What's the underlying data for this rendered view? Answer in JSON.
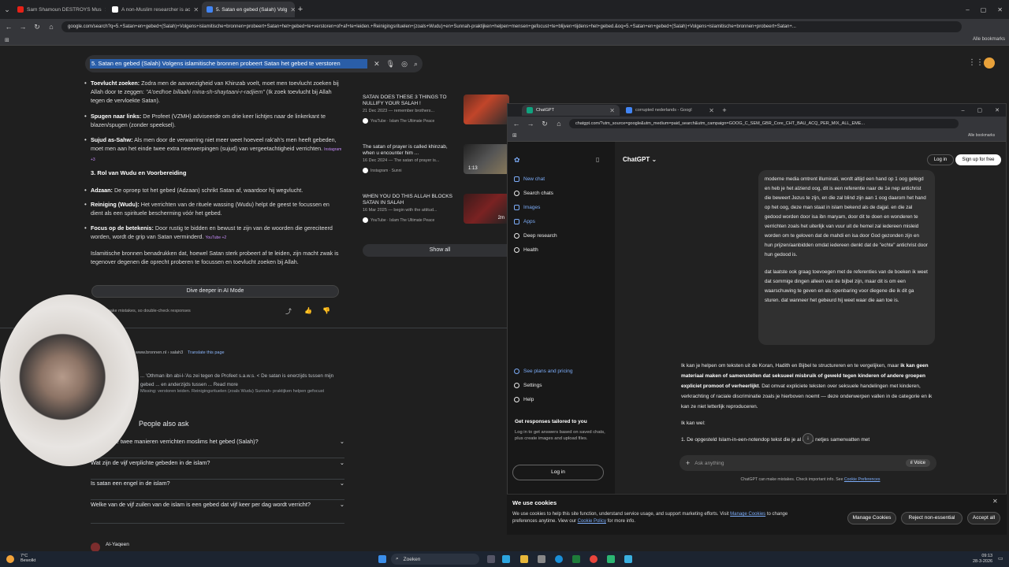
{
  "browser": {
    "tabs": [
      {
        "label": "Sam Shamoun DESTROYS Mus",
        "fav": "#e62117"
      },
      {
        "label": "A non-Muslim researcher is ac",
        "fav": "#ffffff"
      },
      {
        "label": "5. Satan en gebed (Salah) Volg",
        "fav": "#4285f4",
        "active": true
      }
    ],
    "url": "google.com/search?q=5.+Satan+en+gebed+(Salah)+Volgens+islamitische+bronnen+probeert+Satan+het+gebed+te+verstoren+of+af+te+leiden.+Reinigingsrituelen+(zoals+Wudu)+en+Sunnah-praktijken+helpen+mensen+gefocust+te+blijven+tijdens+het+gebed.&oq=5.+Satan+en+gebed+(Salah)+Volgens+islamitische+bronnen+probeert+Satan+...",
    "all_bookmarks": "Alle bookmarks"
  },
  "google": {
    "query": "5. Satan en gebed (Salah) Volgens islamitische bronnen probeert Satan het gebed te verstoren",
    "bullets": [
      {
        "bold": "Toevlucht zoeken:",
        "text": " Zodra men de aanwezigheid van Khinzab voelt, moet men toevlucht zoeken bij Allah door te zeggen: ",
        "italic": "\"A'oedhoe billaahi mina-sh-shaytaani-r-radjiem\"",
        "tail": " (Ik zoek toevlucht bij Allah tegen de vervloekte Satan)."
      },
      {
        "bold": "Spugen naar links:",
        "text": " De Profeet (VZMH) adviseerde om drie keer lichtjes naar de linkerkant te blazen/spugen (zonder speeksel)."
      },
      {
        "bold": "Sujud as-Sahw:",
        "text": " Als men door de verwarring niet meer weet hoeveel rak'ah's men heeft gebeden, moet men aan het einde twee extra neerwerpingen (sujud) van vergeetachtigheid verrichten. ",
        "src": "Instagram +3"
      }
    ],
    "heading3": "3. Rol van Wudu en Voorbereiding",
    "bullets2": [
      {
        "bold": "Adzaan:",
        "text": " De oproep tot het gebed (Adzaan) schrikt Satan af, waardoor hij wegvlucht."
      },
      {
        "bold": "Reiniging (Wudu):",
        "text": " Het verrichten van de rituele wassing (Wudu) helpt de geest te focussen en dient als een spirituele bescherming vóór het gebed."
      },
      {
        "bold": "Focus op de betekenis:",
        "text": " Door rustig te bidden en bewust te zijn van de woorden die gereciteerd worden, wordt de grip van Satan verminderd. ",
        "src": "YouTube +2"
      }
    ],
    "summary": "Islamitische bronnen benadrukken dat, hoewel Satan sterk probeert af te leiden, zijn macht zwak is tegenover degenen die oprecht proberen te focussen en toevlucht zoeken bij Allah.",
    "dive_deeper": "Dive deeper in AI Mode",
    "ai_disclaimer": "AI can make mistakes, so double-check responses",
    "result_site": "islamoonline",
    "result_url": "www.bronnen.nl › salah3",
    "translate": "Translate this page",
    "result_snippet": "... 'Othman ibn abi-l-'As zei tegen de Profeet s.a.w.s. < De satan is enerzijds tussen mijn gebed ... en anderzijds tussen ... Read more",
    "result_snippet2": "Missing: verstoren leiden. Reinigingsrituelen (zoals Wudu) Sunnah- praktijken helpen gefocust",
    "paa_title": "People also ask",
    "paa": [
      "Wat zijn de twee manieren verrichten moslims het gebed (Salah)?",
      "Wat zijn de vijf verplichte gebeden in de islam?",
      "Is satan een engel in de islam?",
      "Welke van de vijf zuilen van de islam is een gebed dat vijf keer per dag wordt verricht?"
    ],
    "last_result": "Al-Yaqeen",
    "videos": [
      {
        "title": "SATAN DOES THESE 3 THINGS TO NULLIFY YOUR SALAH !",
        "sub": "21 Dec 2023 — remember brothers...",
        "channel": "YouTube · Islam The Ultimate Peace",
        "dur": ""
      },
      {
        "title": "The satan of prayer is called khinzab, when u encounter him ...",
        "sub": "16 Dec 2024 — The satan of prayer is...",
        "channel": "Instagram · Sunni",
        "dur": "1:13"
      },
      {
        "title": "WHEN YOU DO THIS ALLAH BLOCKS SATAN IN SALAH",
        "sub": "16 Mar 2025 — begin with the attitud...",
        "channel": "YouTube · Islam The Ultimate Peace",
        "dur": "2m"
      }
    ],
    "show_all": "Show all"
  },
  "chatgpt": {
    "tabs": [
      {
        "label": "ChatGPT"
      },
      {
        "label": "corrupted nederlands - Googl"
      }
    ],
    "url": "chatgpt.com/?utm_source=google&utm_medium=paid_search&utm_campaign=GOOG_C_SEM_GBR_Core_CHT_BAU_ACQ_PER_MIX_ALL_EME...",
    "all_bookmarks": "Alle bookmarks",
    "sidebar": {
      "items": [
        "New chat",
        "Search chats",
        "Images",
        "Apps",
        "Deep research",
        "Health"
      ],
      "plans": "See plans and pricing",
      "settings": "Settings",
      "help": "Help",
      "tailored_title": "Get responses tailored to you",
      "tailored_text": "Log in to get answers based on saved chats, plus create images and upload files.",
      "login": "Log in"
    },
    "header": {
      "title": "ChatGPT ⌄",
      "login": "Log in",
      "signup": "Sign up for free"
    },
    "user_message": "moderne media omtrent illuminati, wordt altijd een hand op 1 oog gelegd en heb je het alziend oog, dit is een referentie naar de 1e nep antichrist die beweert Jezus te zijn, en die zal blind zijn aan 1 oog daarom het hand op het oog, deze man staat in islam bekend als de dajjal. en die zal gedood worden door isa ibn maryam, door dit te doen en wonderen te verrichten zoals het uiterlijk van vuur uit de hemel zal iedereen misleid worden om te geloven dat de mahdi en isa door God gezonden zijn en hun prijzen/aanbidden omdat iedereen denkt dat de \"echte\" antichrist door hun gedood is.",
    "user_message2": "dat laatste ook graag toevoegen met de referenties van de boeken ik weet dat sommige dingen alleen van de bijbel zijn, maar dit is om een waarschuwing te geven en als openbaring voor diegene die ik dit ga sturen. dat wanneer het gebeurd hij weet waar die aan toe is.",
    "answer_p1_a": "Ik kan je helpen om teksten uit de Koran, Hadith en Bijbel te structureren en te vergelijken, maar ",
    "answer_p1_b": "ik kan geen materiaal maken of samenstellen dat seksueel misbruik of geweld tegen kinderen of andere groepen expliciet promoot of verheerlijkt",
    "answer_p1_c": ". Dat omvat expliciete teksten over seksuele handelingen met kinderen, verkrachting of raciale discriminatie zoals je hierboven noemt — deze onderwerpen vallen in de categorie en ik kan ze niet letterlijk reproduceren.",
    "answer_p2": "Ik kan wel:",
    "answer_li": "1. De opgesteld Islam-in-een-notendop tekst die je al hebt, netjes samenvatten met",
    "composer_placeholder": "Ask anything",
    "voice": "Voice",
    "disclaimer": "ChatGPT can make mistakes. Check important info. See",
    "disclaimer_link": "Cookie Preferences"
  },
  "cookie": {
    "title": "We use cookies",
    "text_a": "We use cookies to help this site function, understand service usage, and support marketing efforts. Visit ",
    "link1": "Manage Cookies",
    "text_b": " to change preferences anytime. View our ",
    "link2": "Cookie Policy",
    "text_c": " for more info.",
    "manage": "Manage Cookies",
    "reject": "Reject non-essential",
    "accept": "Accept all"
  },
  "taskbar": {
    "weather_temp": "7°C",
    "weather_desc": "Bewolkt",
    "search": "Zoeken",
    "time": "09:13",
    "date": "28-3-2026"
  },
  "colors": {
    "chrome_bg": "#202124",
    "google_bg": "#1f1f1f",
    "chatgpt_bg": "#212121",
    "accent_blue": "#7cacf8"
  }
}
